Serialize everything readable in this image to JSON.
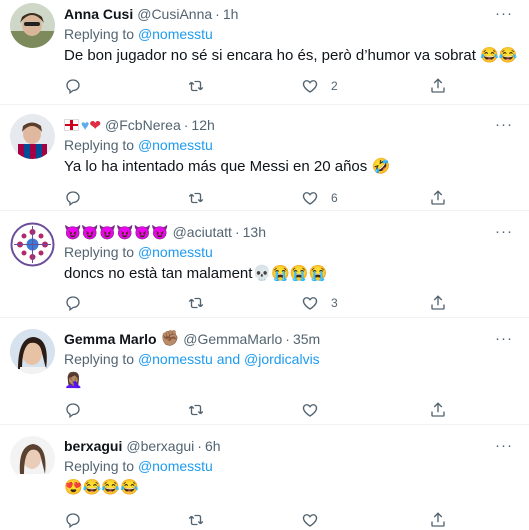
{
  "tweets": [
    {
      "name": "Anna Cusi",
      "handle": "@CusiAnna",
      "time": "1h",
      "reply_prefix": "Replying to",
      "reply_to": "@nomesstu",
      "text": "De bon jugador no sé si encara ho és, però d’humor va sobrat",
      "emoji": "😂😂",
      "likes": "2"
    },
    {
      "name_emoji": "❤",
      "handle": "@FcbNerea",
      "time": "12h",
      "reply_prefix": "Replying to",
      "reply_to": "@nomesstu",
      "text": "Ya lo ha intentado más que Messi en 20 años",
      "emoji": "🤣",
      "likes": "6"
    },
    {
      "name_emoji": "😈😈😈😈😈😈",
      "handle": "@aciutatt",
      "time": "13h",
      "reply_prefix": "Replying to",
      "reply_to": "@nomesstu",
      "text": "doncs no està tan malament",
      "emoji": "💀😭😭😭",
      "likes": "3"
    },
    {
      "name": "Gemma Marlo",
      "name_emoji": "✊🏽",
      "handle": "@GemmaMarlo",
      "time": "35m",
      "reply_prefix": "Replying to",
      "reply_to": "@nomesstu",
      "reply_and": "and",
      "reply_to_2": "@jordicalvis",
      "emoji": "🤦🏽‍♀️",
      "likes": ""
    },
    {
      "name": "berxagui",
      "handle": "@berxagui",
      "time": "6h",
      "reply_prefix": "Replying to",
      "reply_to": "@nomesstu",
      "emoji": "😍😂😂😂",
      "likes": ""
    }
  ],
  "icons": {
    "more": "more-icon",
    "reply": "reply-icon",
    "retweet": "retweet-icon",
    "like": "like-icon",
    "share": "share-icon"
  },
  "colors": {
    "link": "#1d9bf0",
    "secondary": "#536471",
    "divider": "#eff3f4"
  }
}
